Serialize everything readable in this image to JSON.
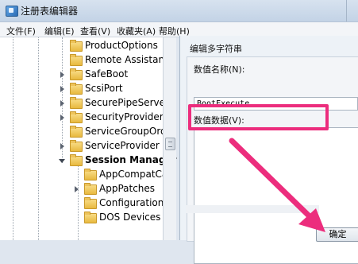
{
  "window": {
    "title": "注册表编辑器"
  },
  "menu": [
    {
      "label": "文件(F)"
    },
    {
      "label": "编辑(E)"
    },
    {
      "label": "查看(V)"
    },
    {
      "label": "收藏夹(A)"
    },
    {
      "label": "帮助(H)"
    }
  ],
  "tree": {
    "items": [
      {
        "label": "ProductOptions",
        "expander": "none"
      },
      {
        "label": "Remote Assistance",
        "expander": "none"
      },
      {
        "label": "SafeBoot",
        "expander": "collapsed"
      },
      {
        "label": "ScsiPort",
        "expander": "collapsed"
      },
      {
        "label": "SecurePipeServers",
        "expander": "collapsed"
      },
      {
        "label": "SecurityProviders",
        "expander": "collapsed"
      },
      {
        "label": "ServiceGroupOrder",
        "expander": "none"
      },
      {
        "label": "ServiceProvider",
        "expander": "collapsed"
      },
      {
        "label": "Session Manager",
        "expander": "expanded",
        "selected": true
      }
    ],
    "children": [
      {
        "label": "AppCompatCac",
        "expander": "none"
      },
      {
        "label": "AppPatches",
        "expander": "collapsed"
      },
      {
        "label": "Configuration M",
        "expander": "none"
      },
      {
        "label": "DOS Devices",
        "expander": "none"
      }
    ]
  },
  "dialog": {
    "title": "编辑多字符串",
    "value_name_label": "数值名称(N):",
    "value_name": "BootExecute",
    "value_data_label": "数值数据(V):",
    "value_data": "",
    "ok_label": "确定"
  },
  "colors": {
    "annotation": "#ec2d7d",
    "folder": "#e8b93f"
  },
  "icons": {
    "app": "registry-editor-icon",
    "tree_item": "folder-icon",
    "annotation_arrow": "arrow-annotation"
  }
}
